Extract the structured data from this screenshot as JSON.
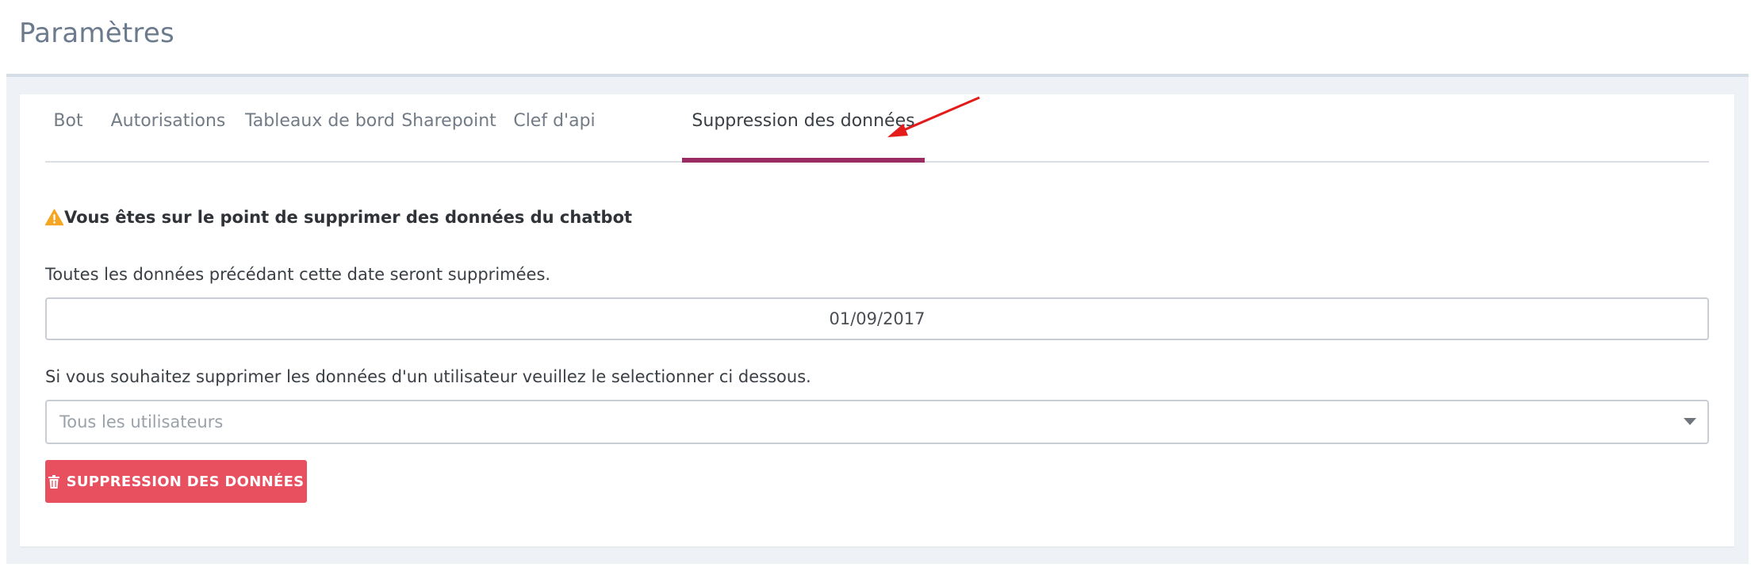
{
  "page": {
    "title": "Paramètres"
  },
  "tabs": [
    {
      "label": "Bot",
      "active": false
    },
    {
      "label": "Autorisations",
      "active": false
    },
    {
      "label": "Tableaux de bord",
      "active": false
    },
    {
      "label": "Sharepoint",
      "active": false
    },
    {
      "label": "Clef d'api",
      "active": false
    },
    {
      "label": "Suppression des données",
      "active": true
    }
  ],
  "content": {
    "warning_icon": "warning-triangle-icon",
    "warning_text": "Vous êtes sur le point de supprimer des données du chatbot",
    "date_label": "Toutes les données précédant cette date seront supprimées.",
    "date_value": "01/09/2017",
    "user_label": "Si vous souhaitez supprimer les données d'un utilisateur veuillez le selectionner ci dessous.",
    "user_select_placeholder": "Tous les utilisateurs",
    "delete_button_label": "SUPPRESSION DES DONNÉES",
    "delete_button_icon": "trash-icon"
  },
  "colors": {
    "accent_tab": "#9a2c63",
    "danger": "#e8505f",
    "warning": "#f5a623",
    "annotation_arrow": "#e31b1b"
  }
}
